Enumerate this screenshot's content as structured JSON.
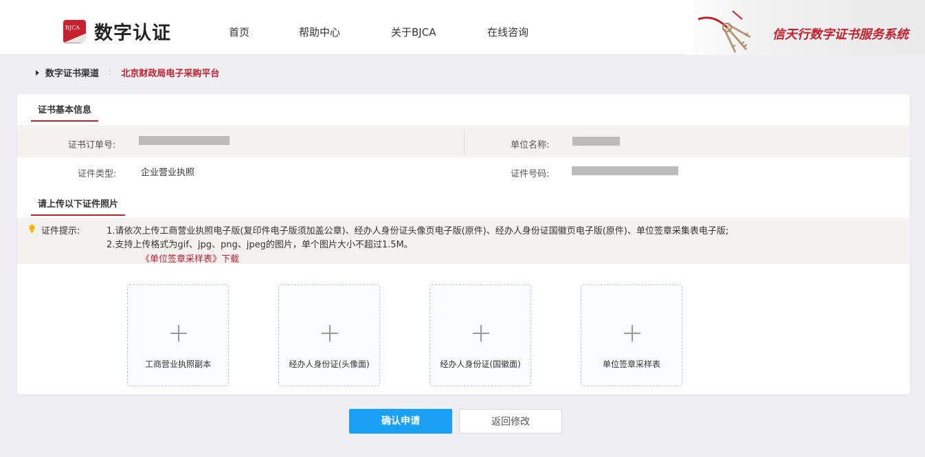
{
  "header": {
    "logo_badge": "BJCA",
    "logo_text": "数字认证",
    "nav": [
      "首页",
      "帮助中心",
      "关于BJCA",
      "在线咨询"
    ],
    "banner_title": "信天行数字证书服务系统"
  },
  "breadcrumb": {
    "label": "数字证书渠道",
    "separator": ":",
    "value": "北京财政局电子采购平台"
  },
  "basic_info": {
    "title": "证书基本信息",
    "order_no_label": "证书订单号:",
    "unit_name_label": "单位名称:",
    "cert_type_label": "证件类型:",
    "cert_type_value": "企业营业执照",
    "cert_no_label": "证件号码:"
  },
  "upload_section": {
    "title": "请上传以下证件照片",
    "tip_label": "证件提示:",
    "tip_line1": "1.请依次上传工商营业执照电子版(复印件电子版须加盖公章)、经办人身份证头像页电子版(原件)、经办人身份证国徽页电子版(原件)、单位签章采集表电子版;",
    "tip_line2": "2.支持上传格式为gif、jpg、png、jpeg的图片，单个图片大小不超过1.5M。",
    "download_link": "《单位签章采样表》下载",
    "uploads": [
      "工商营业执照副本",
      "经办人身份证(头像面)",
      "经办人身份证(国徽面)",
      "单位签章采样表"
    ]
  },
  "actions": {
    "confirm": "确认申请",
    "back": "返回修改"
  },
  "colors": {
    "accent": "#c01f2c",
    "primary_button": "#1aa1f5",
    "background": "#efeff3"
  }
}
